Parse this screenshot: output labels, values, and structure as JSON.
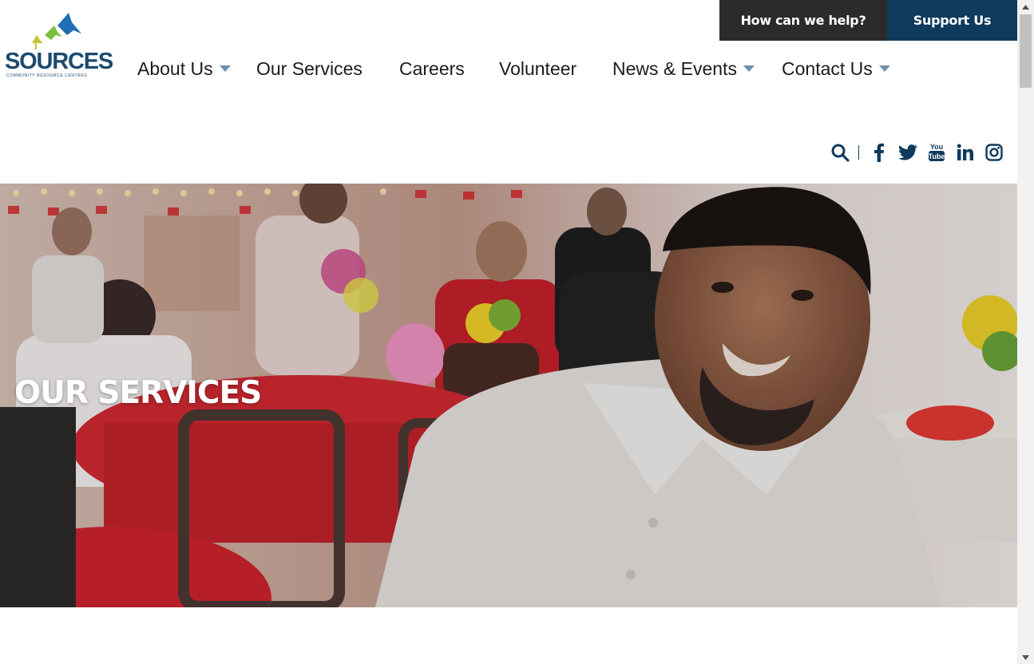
{
  "logo": {
    "wordmark": "SOURCES",
    "tagline": "COMMUNITY RESOURCE CENTRES"
  },
  "utility": {
    "help_label": "How can we help?",
    "support_label": "Support Us"
  },
  "nav": {
    "items": [
      {
        "label": "About Us",
        "has_dropdown": true
      },
      {
        "label": "Our Services",
        "has_dropdown": false
      },
      {
        "label": "Careers",
        "has_dropdown": false
      },
      {
        "label": "Volunteer",
        "has_dropdown": false
      },
      {
        "label": "News & Events",
        "has_dropdown": true
      },
      {
        "label": "Contact Us",
        "has_dropdown": true
      }
    ]
  },
  "social": {
    "icons": [
      "search-icon",
      "facebook-icon",
      "twitter-icon",
      "youtube-icon",
      "linkedin-icon",
      "instagram-icon"
    ]
  },
  "hero": {
    "title": "OUR SERVICES"
  },
  "colors": {
    "brand_navy": "#0f3a5c",
    "dark_button": "#2b2b2b",
    "nav_caret": "#6f8fab",
    "nav_text": "#1b1b1b"
  }
}
